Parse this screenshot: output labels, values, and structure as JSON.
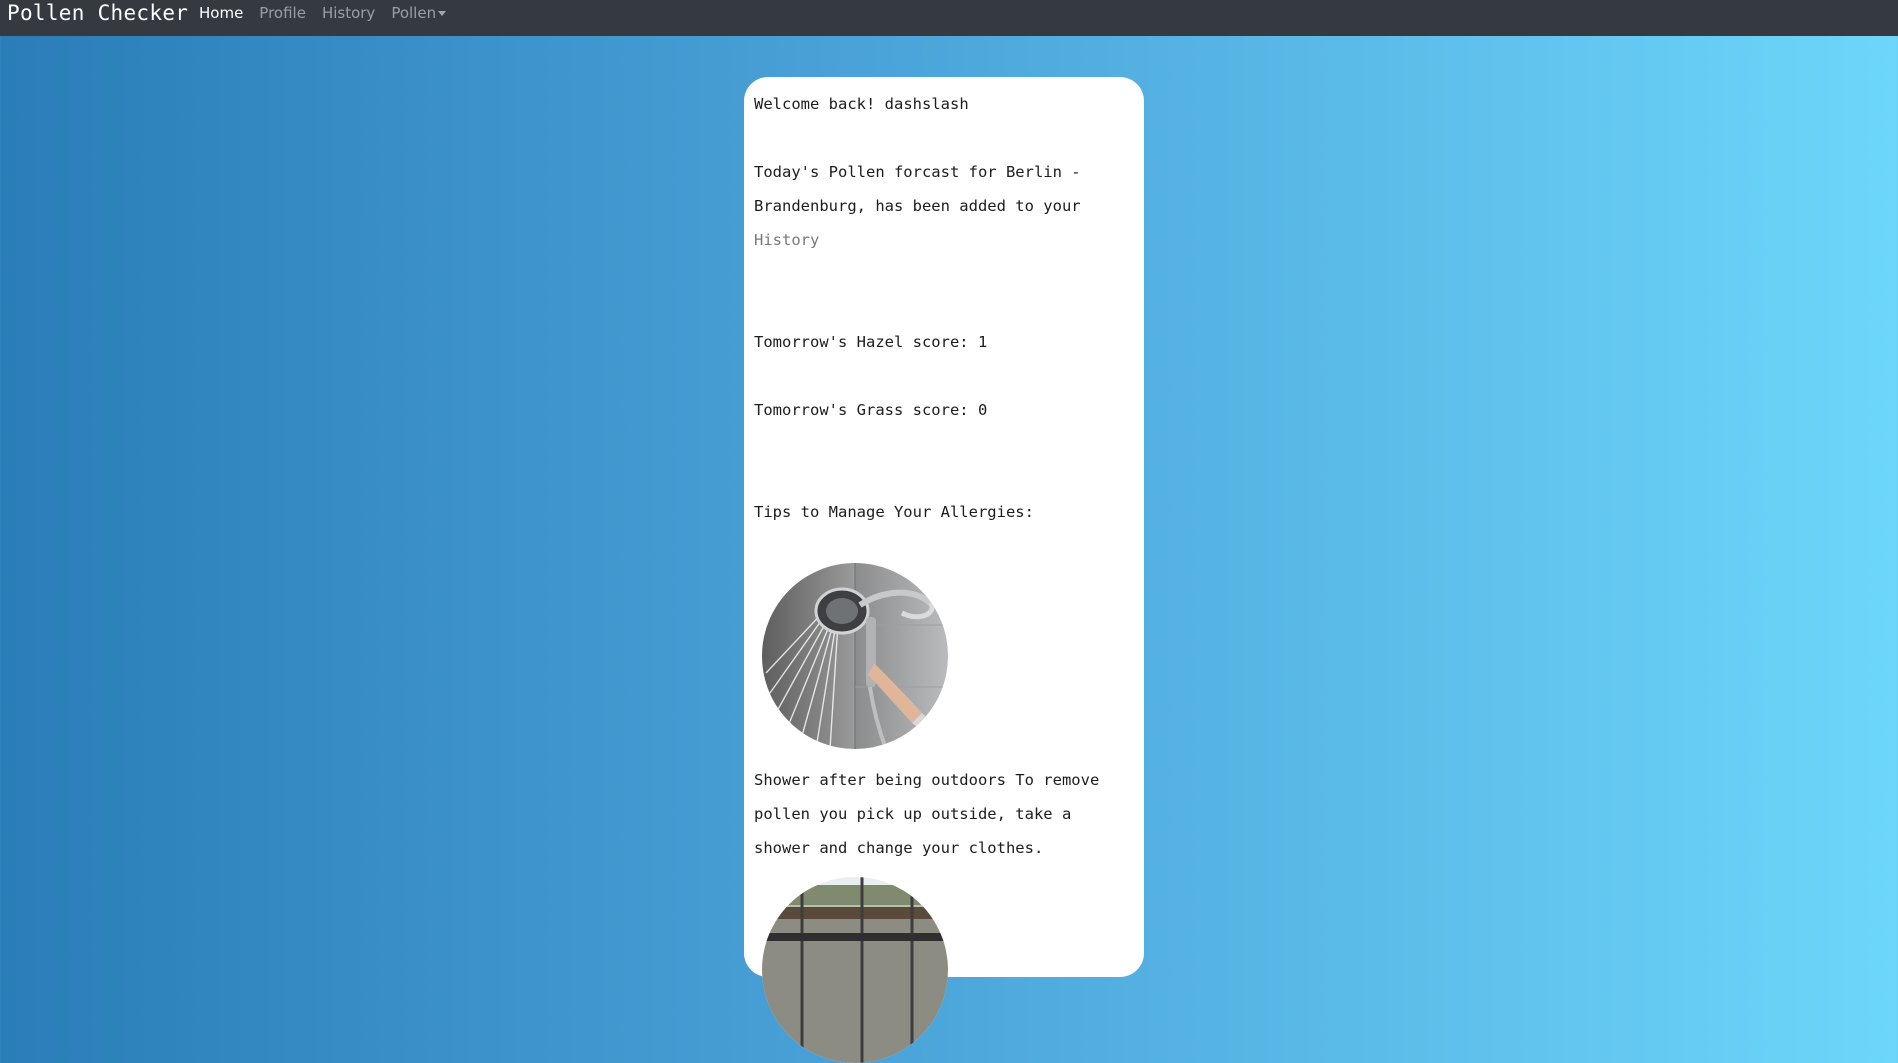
{
  "nav": {
    "brand": "Pollen Checker",
    "items": [
      {
        "label": "Home",
        "active": true
      },
      {
        "label": "Profile",
        "active": false
      },
      {
        "label": "History",
        "active": false
      },
      {
        "label": "Pollen",
        "active": false
      }
    ]
  },
  "card": {
    "welcome_prefix": "Welcome back!",
    "username": "dashslash",
    "forecast_text": "Today's Pollen forcast for Berlin - Brandenburg, has been added to your",
    "history_link": "History",
    "scores": [
      {
        "label": "Tomorrow's Hazel score:",
        "value": "1"
      },
      {
        "label": "Tomorrow's Grass score:",
        "value": "0"
      }
    ],
    "tips_heading": "Tips to Manage Your Allergies:",
    "tips": [
      {
        "image": "shower-head-photo",
        "text": "Shower after being outdoors To remove pollen you pick up outside, take a shower and change your clothes."
      },
      {
        "image": "window-photo",
        "text": ""
      }
    ]
  },
  "colors": {
    "navbar": "#343a40",
    "gradient_start": "#2a7db8",
    "gradient_end": "#6dd6fa",
    "card": "#ffffff"
  }
}
